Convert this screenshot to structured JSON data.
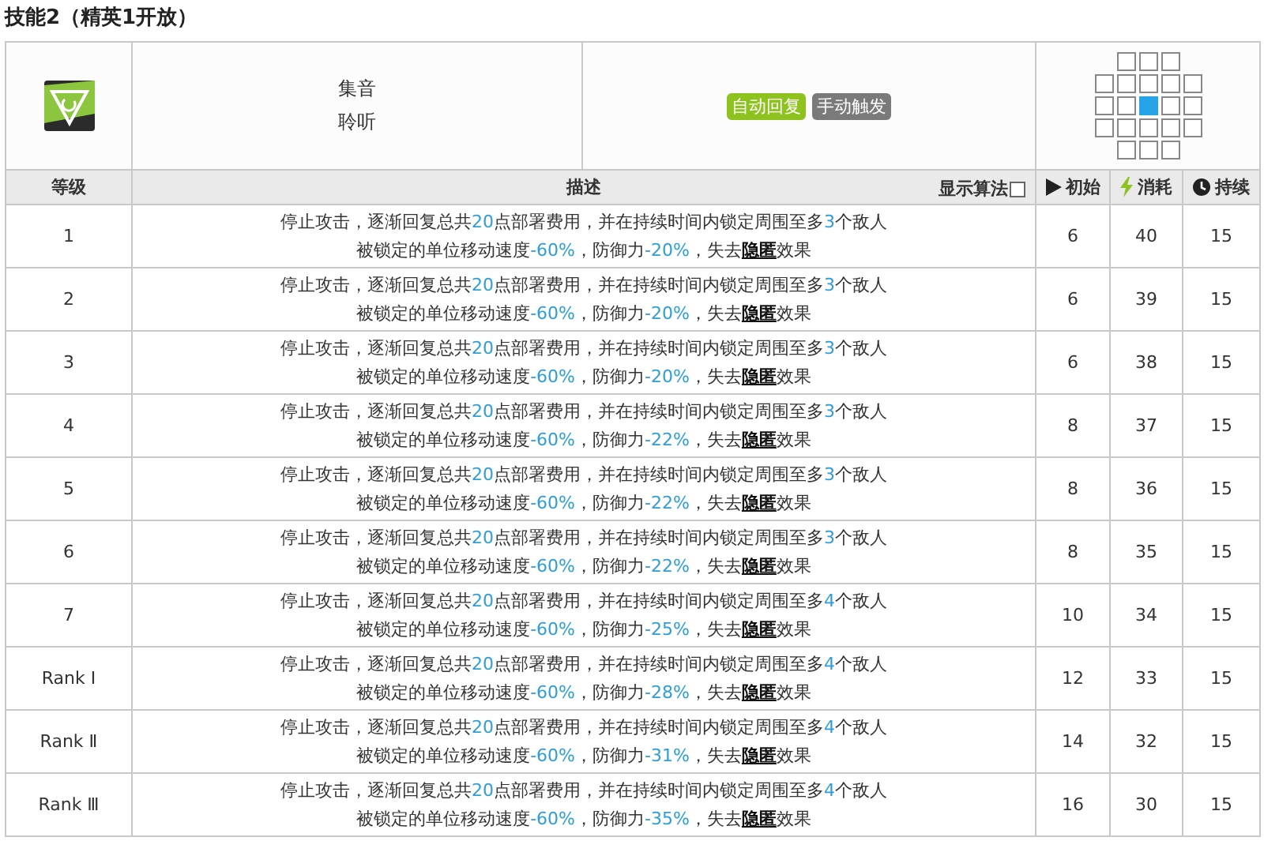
{
  "section_title": "技能2（精英1开放）",
  "skill": {
    "name": "集音",
    "subtitle": "聆听",
    "tags": [
      {
        "label": "自动回复",
        "color": "#8dc21f"
      },
      {
        "label": "手动触发",
        "color": "#7a7a7a"
      }
    ],
    "range": [
      [
        {
          "selected": false
        },
        {
          "selected": false
        },
        {
          "selected": false
        }
      ],
      [
        {
          "selected": false
        },
        {
          "selected": false
        },
        {
          "selected": false
        },
        {
          "selected": false
        },
        {
          "selected": false
        }
      ],
      [
        {
          "selected": false
        },
        {
          "selected": false
        },
        {
          "selected": true
        },
        {
          "selected": false
        },
        {
          "selected": false
        }
      ],
      [
        {
          "selected": false
        },
        {
          "selected": false
        },
        {
          "selected": false
        },
        {
          "selected": false
        },
        {
          "selected": false
        }
      ],
      [
        {
          "selected": false
        },
        {
          "selected": false
        },
        {
          "selected": false
        }
      ]
    ]
  },
  "columns": {
    "level": "等级",
    "description": "描述",
    "show_formula": {
      "label": "显示算法",
      "checked": false
    },
    "initial": "初始",
    "cost": "消耗",
    "duration": "持续"
  },
  "rows": [
    {
      "level": "1",
      "lines": [
        [
          {
            "text": "停止攻击，逐渐回复总共",
            "kind": "plain"
          },
          {
            "text": "20",
            "kind": "value"
          },
          {
            "text": "点部署费用，并在持续时间内锁定周围至多",
            "kind": "plain"
          },
          {
            "text": "3",
            "kind": "value"
          },
          {
            "text": "个敌人",
            "kind": "plain"
          }
        ],
        [
          {
            "text": "被锁定的单位移动速度",
            "kind": "plain"
          },
          {
            "text": "-60%",
            "kind": "value"
          },
          {
            "text": "，防御力",
            "kind": "plain"
          },
          {
            "text": "-20%",
            "kind": "value"
          },
          {
            "text": "，失去",
            "kind": "plain"
          },
          {
            "text": "隐匿",
            "kind": "term"
          },
          {
            "text": "效果",
            "kind": "plain"
          }
        ]
      ],
      "initial": "6",
      "cost": "40",
      "duration": "15"
    },
    {
      "level": "2",
      "lines": [
        [
          {
            "text": "停止攻击，逐渐回复总共",
            "kind": "plain"
          },
          {
            "text": "20",
            "kind": "value"
          },
          {
            "text": "点部署费用，并在持续时间内锁定周围至多",
            "kind": "plain"
          },
          {
            "text": "3",
            "kind": "value"
          },
          {
            "text": "个敌人",
            "kind": "plain"
          }
        ],
        [
          {
            "text": "被锁定的单位移动速度",
            "kind": "plain"
          },
          {
            "text": "-60%",
            "kind": "value"
          },
          {
            "text": "，防御力",
            "kind": "plain"
          },
          {
            "text": "-20%",
            "kind": "value"
          },
          {
            "text": "，失去",
            "kind": "plain"
          },
          {
            "text": "隐匿",
            "kind": "term"
          },
          {
            "text": "效果",
            "kind": "plain"
          }
        ]
      ],
      "initial": "6",
      "cost": "39",
      "duration": "15"
    },
    {
      "level": "3",
      "lines": [
        [
          {
            "text": "停止攻击，逐渐回复总共",
            "kind": "plain"
          },
          {
            "text": "20",
            "kind": "value"
          },
          {
            "text": "点部署费用，并在持续时间内锁定周围至多",
            "kind": "plain"
          },
          {
            "text": "3",
            "kind": "value"
          },
          {
            "text": "个敌人",
            "kind": "plain"
          }
        ],
        [
          {
            "text": "被锁定的单位移动速度",
            "kind": "plain"
          },
          {
            "text": "-60%",
            "kind": "value"
          },
          {
            "text": "，防御力",
            "kind": "plain"
          },
          {
            "text": "-20%",
            "kind": "value"
          },
          {
            "text": "，失去",
            "kind": "plain"
          },
          {
            "text": "隐匿",
            "kind": "term"
          },
          {
            "text": "效果",
            "kind": "plain"
          }
        ]
      ],
      "initial": "6",
      "cost": "38",
      "duration": "15"
    },
    {
      "level": "4",
      "lines": [
        [
          {
            "text": "停止攻击，逐渐回复总共",
            "kind": "plain"
          },
          {
            "text": "20",
            "kind": "value"
          },
          {
            "text": "点部署费用，并在持续时间内锁定周围至多",
            "kind": "plain"
          },
          {
            "text": "3",
            "kind": "value"
          },
          {
            "text": "个敌人",
            "kind": "plain"
          }
        ],
        [
          {
            "text": "被锁定的单位移动速度",
            "kind": "plain"
          },
          {
            "text": "-60%",
            "kind": "value"
          },
          {
            "text": "，防御力",
            "kind": "plain"
          },
          {
            "text": "-22%",
            "kind": "value"
          },
          {
            "text": "，失去",
            "kind": "plain"
          },
          {
            "text": "隐匿",
            "kind": "term"
          },
          {
            "text": "效果",
            "kind": "plain"
          }
        ]
      ],
      "initial": "8",
      "cost": "37",
      "duration": "15"
    },
    {
      "level": "5",
      "lines": [
        [
          {
            "text": "停止攻击，逐渐回复总共",
            "kind": "plain"
          },
          {
            "text": "20",
            "kind": "value"
          },
          {
            "text": "点部署费用，并在持续时间内锁定周围至多",
            "kind": "plain"
          },
          {
            "text": "3",
            "kind": "value"
          },
          {
            "text": "个敌人",
            "kind": "plain"
          }
        ],
        [
          {
            "text": "被锁定的单位移动速度",
            "kind": "plain"
          },
          {
            "text": "-60%",
            "kind": "value"
          },
          {
            "text": "，防御力",
            "kind": "plain"
          },
          {
            "text": "-22%",
            "kind": "value"
          },
          {
            "text": "，失去",
            "kind": "plain"
          },
          {
            "text": "隐匿",
            "kind": "term"
          },
          {
            "text": "效果",
            "kind": "plain"
          }
        ]
      ],
      "initial": "8",
      "cost": "36",
      "duration": "15"
    },
    {
      "level": "6",
      "lines": [
        [
          {
            "text": "停止攻击，逐渐回复总共",
            "kind": "plain"
          },
          {
            "text": "20",
            "kind": "value"
          },
          {
            "text": "点部署费用，并在持续时间内锁定周围至多",
            "kind": "plain"
          },
          {
            "text": "3",
            "kind": "value"
          },
          {
            "text": "个敌人",
            "kind": "plain"
          }
        ],
        [
          {
            "text": "被锁定的单位移动速度",
            "kind": "plain"
          },
          {
            "text": "-60%",
            "kind": "value"
          },
          {
            "text": "，防御力",
            "kind": "plain"
          },
          {
            "text": "-22%",
            "kind": "value"
          },
          {
            "text": "，失去",
            "kind": "plain"
          },
          {
            "text": "隐匿",
            "kind": "term"
          },
          {
            "text": "效果",
            "kind": "plain"
          }
        ]
      ],
      "initial": "8",
      "cost": "35",
      "duration": "15"
    },
    {
      "level": "7",
      "lines": [
        [
          {
            "text": "停止攻击，逐渐回复总共",
            "kind": "plain"
          },
          {
            "text": "20",
            "kind": "value"
          },
          {
            "text": "点部署费用，并在持续时间内锁定周围至多",
            "kind": "plain"
          },
          {
            "text": "4",
            "kind": "value"
          },
          {
            "text": "个敌人",
            "kind": "plain"
          }
        ],
        [
          {
            "text": "被锁定的单位移动速度",
            "kind": "plain"
          },
          {
            "text": "-60%",
            "kind": "value"
          },
          {
            "text": "，防御力",
            "kind": "plain"
          },
          {
            "text": "-25%",
            "kind": "value"
          },
          {
            "text": "，失去",
            "kind": "plain"
          },
          {
            "text": "隐匿",
            "kind": "term"
          },
          {
            "text": "效果",
            "kind": "plain"
          }
        ]
      ],
      "initial": "10",
      "cost": "34",
      "duration": "15"
    },
    {
      "level": "Rank Ⅰ",
      "lines": [
        [
          {
            "text": "停止攻击，逐渐回复总共",
            "kind": "plain"
          },
          {
            "text": "20",
            "kind": "value"
          },
          {
            "text": "点部署费用，并在持续时间内锁定周围至多",
            "kind": "plain"
          },
          {
            "text": "4",
            "kind": "value"
          },
          {
            "text": "个敌人",
            "kind": "plain"
          }
        ],
        [
          {
            "text": "被锁定的单位移动速度",
            "kind": "plain"
          },
          {
            "text": "-60%",
            "kind": "value"
          },
          {
            "text": "，防御力",
            "kind": "plain"
          },
          {
            "text": "-28%",
            "kind": "value"
          },
          {
            "text": "，失去",
            "kind": "plain"
          },
          {
            "text": "隐匿",
            "kind": "term"
          },
          {
            "text": "效果",
            "kind": "plain"
          }
        ]
      ],
      "initial": "12",
      "cost": "33",
      "duration": "15"
    },
    {
      "level": "Rank Ⅱ",
      "lines": [
        [
          {
            "text": "停止攻击，逐渐回复总共",
            "kind": "plain"
          },
          {
            "text": "20",
            "kind": "value"
          },
          {
            "text": "点部署费用，并在持续时间内锁定周围至多",
            "kind": "plain"
          },
          {
            "text": "4",
            "kind": "value"
          },
          {
            "text": "个敌人",
            "kind": "plain"
          }
        ],
        [
          {
            "text": "被锁定的单位移动速度",
            "kind": "plain"
          },
          {
            "text": "-60%",
            "kind": "value"
          },
          {
            "text": "，防御力",
            "kind": "plain"
          },
          {
            "text": "-31%",
            "kind": "value"
          },
          {
            "text": "，失去",
            "kind": "plain"
          },
          {
            "text": "隐匿",
            "kind": "term"
          },
          {
            "text": "效果",
            "kind": "plain"
          }
        ]
      ],
      "initial": "14",
      "cost": "32",
      "duration": "15"
    },
    {
      "level": "Rank Ⅲ",
      "lines": [
        [
          {
            "text": "停止攻击，逐渐回复总共",
            "kind": "plain"
          },
          {
            "text": "20",
            "kind": "value"
          },
          {
            "text": "点部署费用，并在持续时间内锁定周围至多",
            "kind": "plain"
          },
          {
            "text": "4",
            "kind": "value"
          },
          {
            "text": "个敌人",
            "kind": "plain"
          }
        ],
        [
          {
            "text": "被锁定的单位移动速度",
            "kind": "plain"
          },
          {
            "text": "-60%",
            "kind": "value"
          },
          {
            "text": "，防御力",
            "kind": "plain"
          },
          {
            "text": "-35%",
            "kind": "value"
          },
          {
            "text": "，失去",
            "kind": "plain"
          },
          {
            "text": "隐匿",
            "kind": "term"
          },
          {
            "text": "效果",
            "kind": "plain"
          }
        ]
      ],
      "initial": "16",
      "cost": "30",
      "duration": "15"
    }
  ]
}
